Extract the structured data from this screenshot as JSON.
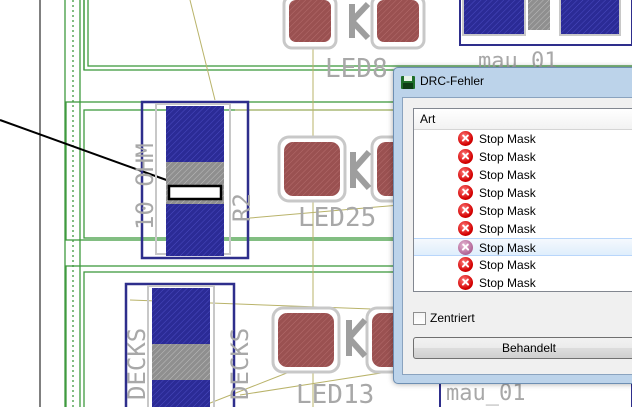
{
  "board": {
    "labels": {
      "led8": "LED8",
      "led25": "LED25",
      "led13": "LED13",
      "vert_top": "10 OHM",
      "vert_side": "R2",
      "decks_left": "DECKS",
      "decks_right": "DECKS",
      "top_right": "mau_01",
      "bottom_right": "mau_01"
    }
  },
  "dialog": {
    "title": "DRC-Fehler",
    "column_header": "Art",
    "items": [
      {
        "label": "Stop Mask"
      },
      {
        "label": "Stop Mask"
      },
      {
        "label": "Stop Mask"
      },
      {
        "label": "Stop Mask"
      },
      {
        "label": "Stop Mask"
      },
      {
        "label": "Stop Mask"
      },
      {
        "label": "Stop Mask"
      },
      {
        "label": "Stop Mask"
      },
      {
        "label": "Stop Mask"
      }
    ],
    "selected_index": 6,
    "checkbox_label": "Zentriert",
    "checkbox_checked": false,
    "button_label": "Behandelt"
  },
  "colors": {
    "pad_blue": "#2b2b96",
    "pad_red": "#9a5151",
    "outline_blue": "#2e2e8c",
    "silk_gray": "#a8a8a8",
    "trace_olive": "#b9b36a",
    "grid_green": "#3f9a3f",
    "error_red": "#d40000"
  },
  "icons": {
    "error": "error-x-icon",
    "app": "floppy-disk-icon"
  }
}
